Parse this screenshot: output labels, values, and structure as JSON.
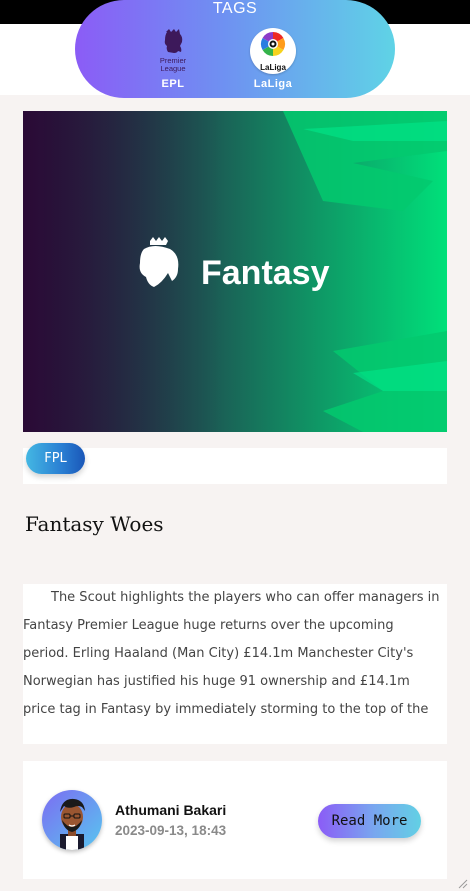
{
  "header": {
    "tags_title": "TAGS",
    "tags": [
      {
        "label": "EPL",
        "icon": "premier-league-logo",
        "logo_text": [
          "Premier",
          "League"
        ]
      },
      {
        "label": "LaLiga",
        "icon": "laliga-logo",
        "logo_text": "LaLiga"
      }
    ]
  },
  "article": {
    "hero_wordmark": "Fantasy",
    "tag_chip": "FPL",
    "title": "Fantasy Woes",
    "excerpt": "The Scout highlights the players who can offer managers in Fantasy Premier League huge returns over the upcoming period. Erling Haaland (Man City) £14.1m Manchester City's Norwegian has justified his huge 91 ownership and £14.1m price tag in Fantasy by immediately storming to the top of the player standings.  Haaland's …"
  },
  "author": {
    "name": "Athumani Bakari",
    "date": "2023-09-13, 18:43"
  },
  "actions": {
    "read_more": "Read More"
  },
  "colors": {
    "accent_purple": "#8b5cf6",
    "accent_cyan": "#5fd3e6",
    "hero_dark": "#2a0a36",
    "hero_green": "#00e07a"
  }
}
